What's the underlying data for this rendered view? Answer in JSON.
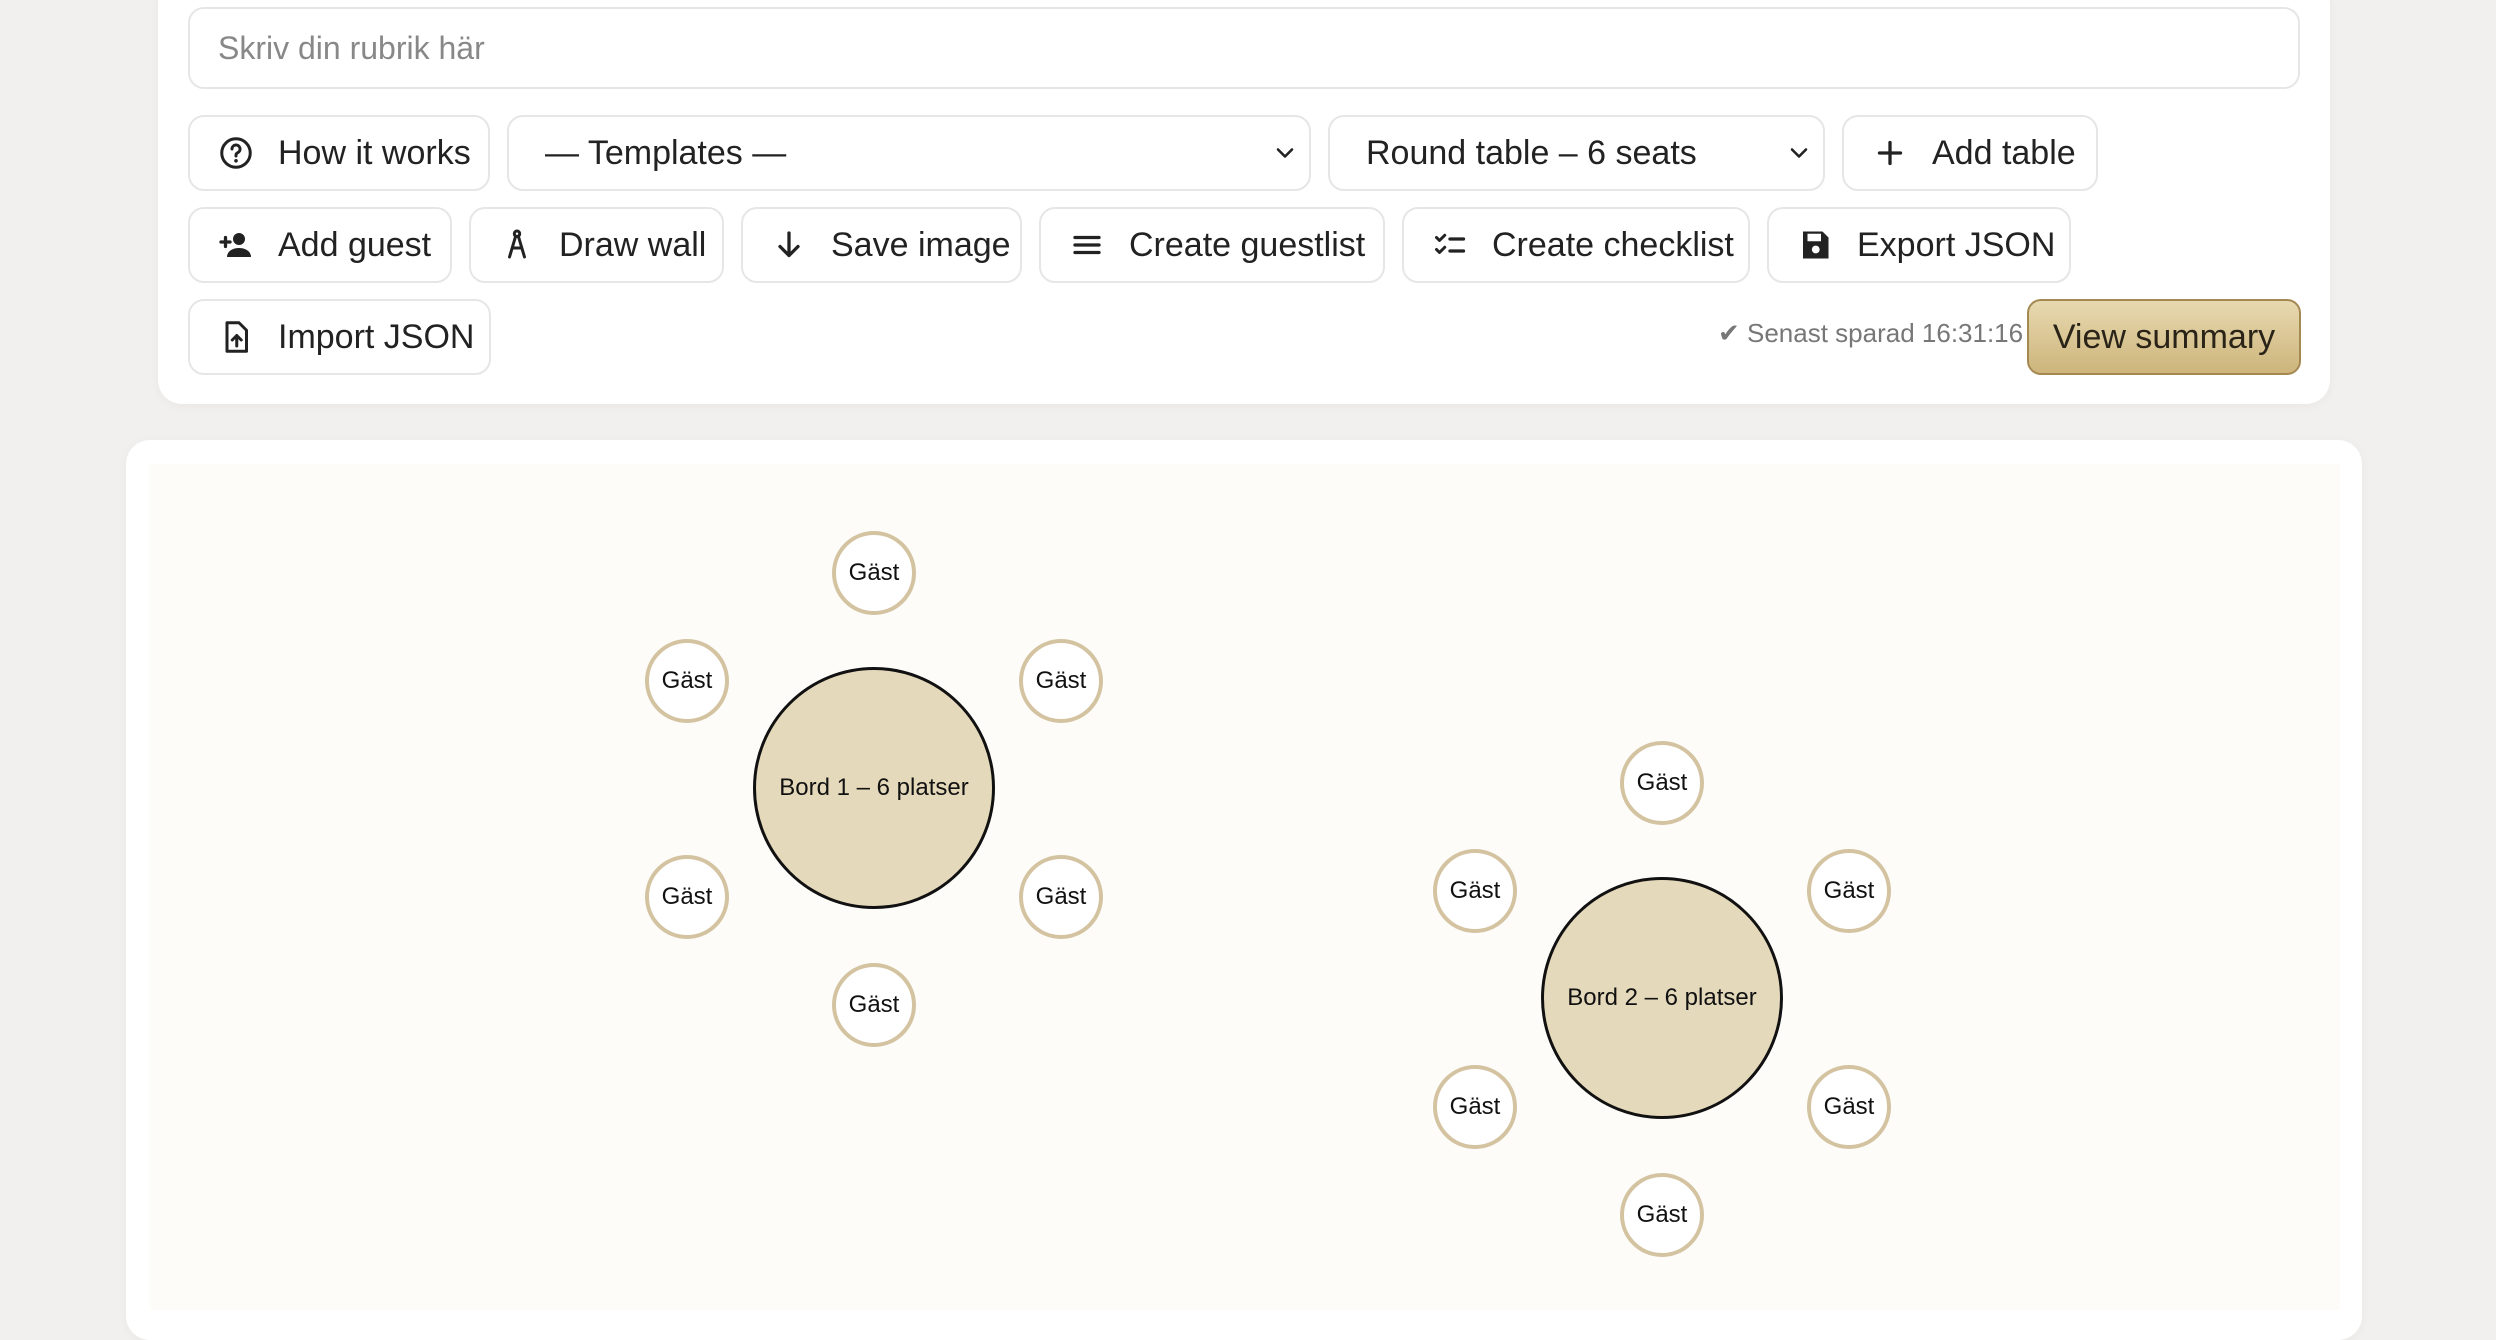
{
  "header": {
    "title_placeholder": "Skriv din rubrik här"
  },
  "toolbar": {
    "how_it_works": "How it works",
    "templates_selected": "— Templates —",
    "table_type_selected": "Round table – 6 seats",
    "add_table": "Add table",
    "add_guest": "Add guest",
    "draw_wall": "Draw wall",
    "save_image": "Save image",
    "create_guestlist": "Create guestlist",
    "create_checklist": "Create checklist",
    "export_json": "Export JSON",
    "import_json": "Import JSON",
    "saved_status": "✔ Senast sparad 16:31:16",
    "view_summary": "View summary"
  },
  "colors": {
    "accent_gold": "#cdb57c",
    "table_fill": "#e5d9bb",
    "seat_border": "#d4c3a1",
    "canvas_bg": "#fdfcf8"
  },
  "floorplan": {
    "tables": [
      {
        "label": "Bord 1 – 6 platser",
        "seats": [
          "Gäst",
          "Gäst",
          "Gäst",
          "Gäst",
          "Gäst",
          "Gäst"
        ]
      },
      {
        "label": "Bord 2 – 6 platser",
        "seats": [
          "Gäst",
          "Gäst",
          "Gäst",
          "Gäst",
          "Gäst",
          "Gäst"
        ]
      }
    ]
  }
}
